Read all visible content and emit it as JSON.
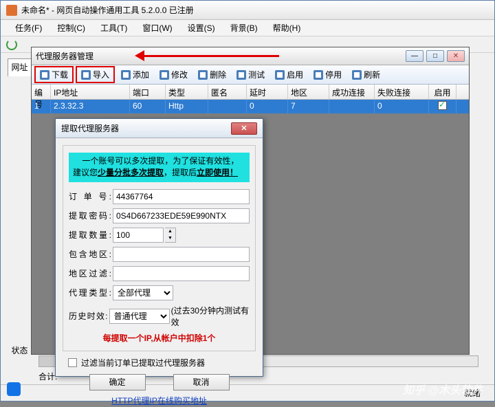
{
  "outer": {
    "title": "未命名* - 网页自动操作通用工具 5.2.0.0  已注册",
    "menus": [
      "任务(F)",
      "控制(C)",
      "工具(T)",
      "窗口(W)",
      "设置(S)",
      "背景(B)",
      "帮助(H)"
    ],
    "side_tab": "网址",
    "side_tab2": "状态",
    "total_label": "合计:",
    "status_ready": "就绪"
  },
  "mdi": {
    "title": "代理服务器管理",
    "toolbar": [
      "下载",
      "导入",
      "添加",
      "修改",
      "删除",
      "测试",
      "启用",
      "停用",
      "刷新"
    ],
    "columns": [
      "编号",
      "IP地址",
      "端口",
      "类型",
      "匿名",
      "延时",
      "地区",
      "成功连接",
      "失败连接",
      "启用"
    ],
    "row": {
      "idx": "1",
      "ip": "2.3.32.3",
      "port": "60",
      "type": "Http",
      "anon": "",
      "lat": "0",
      "reg": "7",
      "succ": "",
      "fail": "0",
      "en": true
    }
  },
  "dialog": {
    "title": "提取代理服务器",
    "hint_l1": "一个账号可以多次提取，为了保证有效性，",
    "hint_l2_a": "建议您",
    "hint_l2_b": "少量分批多次提取",
    "hint_l2_c": "，提取后",
    "hint_l2_d": "立即使用！",
    "labels": {
      "order": "订 单 号:",
      "pw": "提取密码:",
      "qty": "提取数量:",
      "inc": "包含地区:",
      "exc": "地区过滤:",
      "ptype": "代理类型:",
      "hist": "历史时效:"
    },
    "vals": {
      "order": "44367764",
      "pw": "0S4D667233EDE59E990NTX",
      "qty": "100",
      "inc": "",
      "exc": "",
      "ptype": "全部代理",
      "hist_a": "普通代理",
      "hist_b": "(过去30分钟内测试有效"
    },
    "warn": "每提取一个IP,从帐户中扣除1个",
    "filter_chk": "过滤当前订单已提取过代理服务器",
    "ok": "确定",
    "cancel": "取消",
    "link": "HTTP代理IP在线购买地址"
  },
  "watermark": "知乎 @木头软件"
}
